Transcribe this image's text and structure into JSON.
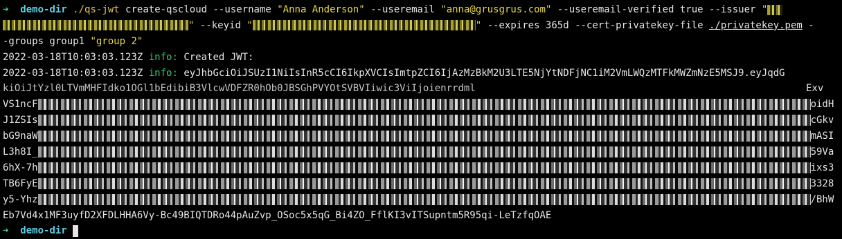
{
  "terminal": {
    "prompt": {
      "arrow": "➜",
      "dir": "demo-dir"
    },
    "command": {
      "path": "./qs-jwt",
      "subcommand": "create-qscloud",
      "username_flag": "--username",
      "username_value": "\"Anna Anderson\"",
      "useremail_flag": "--useremail",
      "useremail_value": "\"anna@grusgrus.com\"",
      "verified_flag": "--useremail-verified true",
      "issuer_flag": "--issuer",
      "issuer_value_start": "\"",
      "keyid_flag": "--keyid",
      "expires_flag": "--expires 365d",
      "cert_flag": "--cert-privatekey-file",
      "cert_value": "./privatekey.pem",
      "groups_tail_1": "-",
      "groups_line_start": "-groups group1",
      "groups_value_2": "\"group 2\""
    },
    "log1": {
      "timestamp": "2022-03-18T10:03:03.123Z",
      "level": "info:",
      "message": "Created JWT:"
    },
    "log2": {
      "timestamp": "2022-03-18T10:03:03.123Z",
      "level": "info:",
      "token_line_1": "eyJhbGciOiJSUzI1NiIsInR5cCI6IkpXVCIsImtpZCI6IjAzMzBkM2U3LTE5NjYtNDFjNC1iM2VmLWQzMTFkMWZmNzE5MSJ9.eyJqdG",
      "token_line_2_start": "kiOiJtYzl0LTVmMHFIdko1OGl1bEdibiB3VlcwVDFZR0hOb0JBSGhPVYOtSVBVIiwic3ViIjoienrrdml",
      "token_line_2_end": "Exv",
      "token_line_3_start": "VS1ncF",
      "token_line_3_end": "oidH",
      "token_line_4_start": "J1ZSIs",
      "token_line_4_end": "cGkv",
      "token_line_5_start": "bG9naW",
      "token_line_5_end": "mASI",
      "token_line_6_start": "L3h8I_",
      "token_line_6_end": "59Va",
      "token_line_7_start": "6hX-7h",
      "token_line_7_end": "ixs3",
      "token_line_8_start": "TB6FyE",
      "token_line_8_end": "3328",
      "token_line_9_start": "y5-Yhz",
      "token_line_9_end": "/BhW",
      "token_line_10": "Eb7Vd4x1MF3uyfD2XFDLHHA6Vy-Bc49BIQTDRo44pAuZvp_OSoc5x5qG_Bi4ZO_FflKI3vITSupntm5R95qi-LeTzfqOAE"
    },
    "colors": {
      "background": "#000000",
      "prompt_arrow": "#38d68a",
      "prompt_dir": "#5fd1e6",
      "string": "#e8d84a",
      "info": "#3ec46d"
    }
  }
}
